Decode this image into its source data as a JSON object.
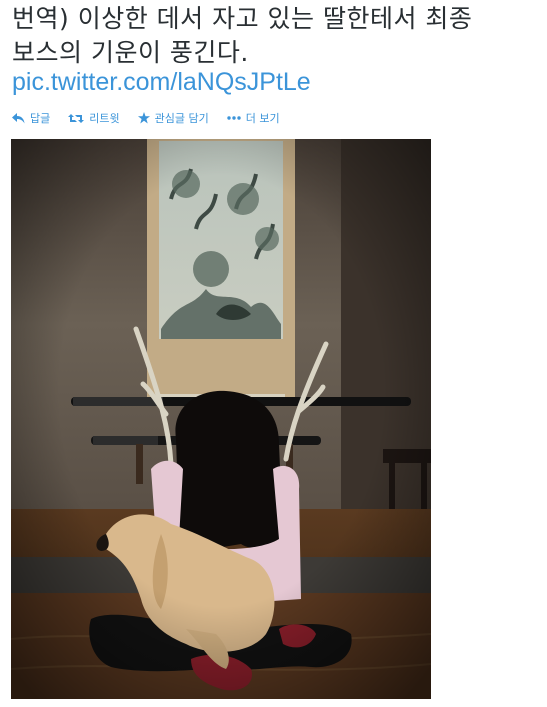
{
  "tweet": {
    "text_line1": "번역) 이상한 데서 자고 있는 딸한테서 최종",
    "text_line2": "보스의 기운이 풍긴다.",
    "link": "pic.twitter.com/laNQsJPtLe"
  },
  "actions": [
    {
      "label": "답글",
      "icon": "reply-icon"
    },
    {
      "label": "리트윗",
      "icon": "retweet-icon"
    },
    {
      "label": "관심글 담기",
      "icon": "star-icon"
    },
    {
      "label": "더 보기",
      "icon": "more-icon"
    }
  ],
  "colors": {
    "link": "#3b94d9",
    "text": "#292f33"
  },
  "photo": {
    "subject": "girl-with-antlers-holding-dog"
  }
}
